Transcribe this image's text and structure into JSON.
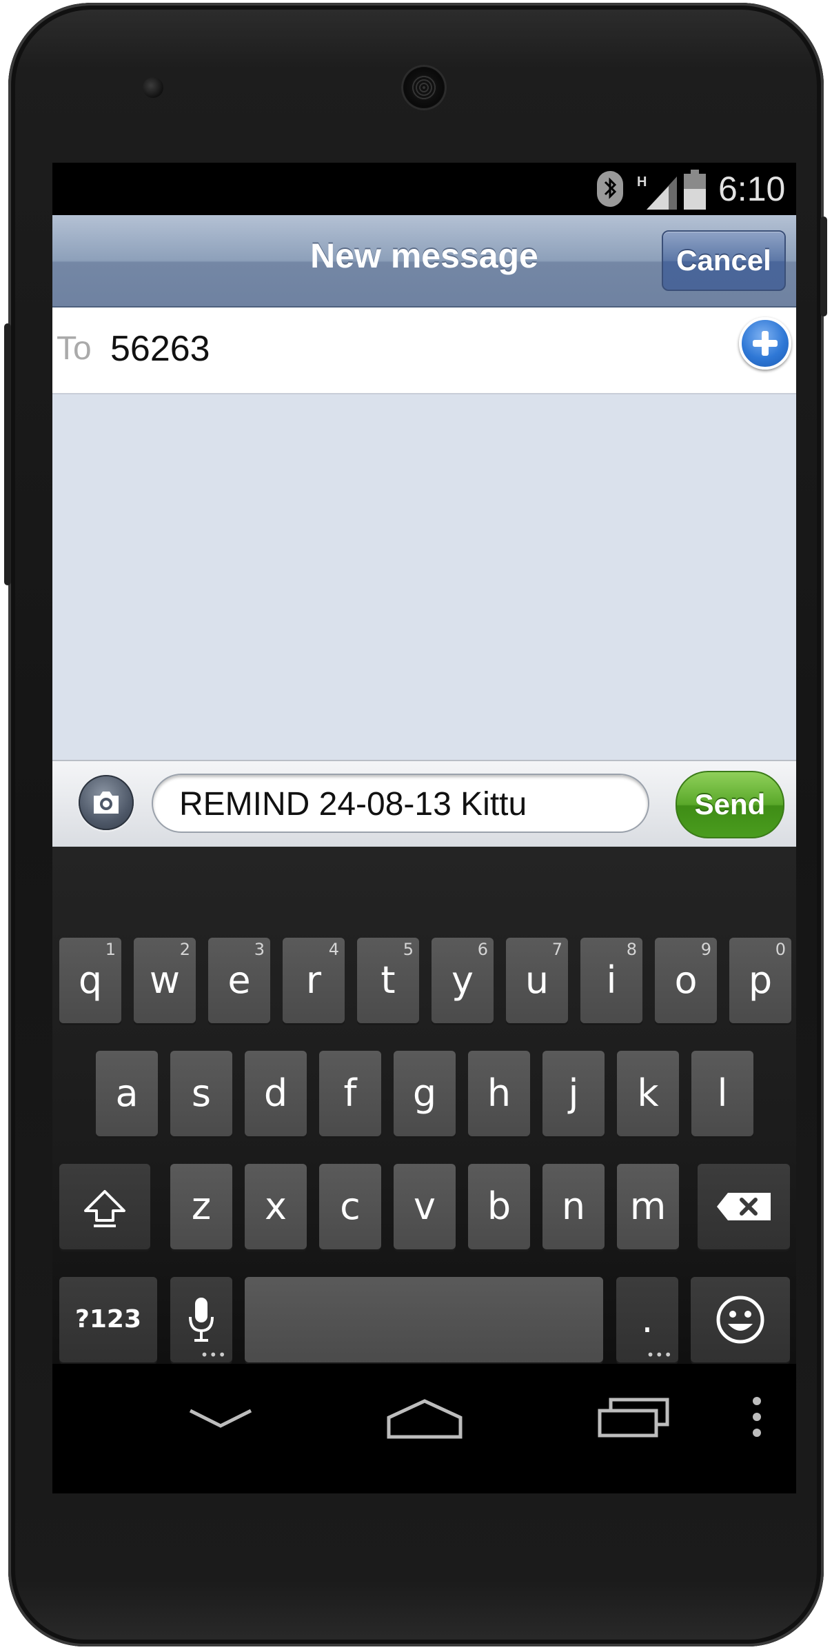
{
  "status_bar": {
    "time": "6:10",
    "network_type": "H",
    "icons": [
      "bluetooth-icon",
      "signal-icon",
      "battery-icon"
    ]
  },
  "header": {
    "title": "New message",
    "cancel_label": "Cancel"
  },
  "recipient": {
    "label": "To",
    "value": "56263",
    "add_icon": "plus-circle-icon"
  },
  "composer": {
    "message_text": "REMIND 24-08-13 Kittu",
    "send_label": "Send",
    "camera_icon": "camera-icon"
  },
  "keyboard": {
    "row1": [
      {
        "k": "q",
        "alt": "1"
      },
      {
        "k": "w",
        "alt": "2"
      },
      {
        "k": "e",
        "alt": "3"
      },
      {
        "k": "r",
        "alt": "4"
      },
      {
        "k": "t",
        "alt": "5"
      },
      {
        "k": "y",
        "alt": "6"
      },
      {
        "k": "u",
        "alt": "7"
      },
      {
        "k": "i",
        "alt": "8"
      },
      {
        "k": "o",
        "alt": "9"
      },
      {
        "k": "p",
        "alt": "0"
      }
    ],
    "row2": [
      "a",
      "s",
      "d",
      "f",
      "g",
      "h",
      "j",
      "k",
      "l"
    ],
    "row3": [
      "z",
      "x",
      "c",
      "v",
      "b",
      "n",
      "m"
    ],
    "symbols_label": "?123",
    "period_label": ".",
    "special_icons": [
      "shift-icon",
      "backspace-icon",
      "microphone-icon",
      "emoji-icon"
    ]
  },
  "nav_bar": {
    "icons": [
      "back-icon",
      "home-icon",
      "recent-apps-icon",
      "menu-icon"
    ]
  },
  "colors": {
    "header_blue": "#7487a5",
    "conversation_bg": "#dae1ec",
    "send_green": "#5aa82a",
    "add_blue": "#2f78d6"
  }
}
